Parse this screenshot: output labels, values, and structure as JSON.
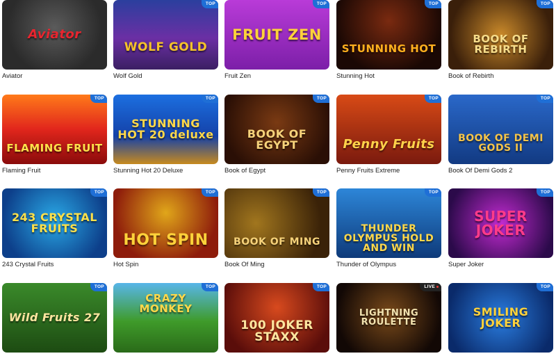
{
  "badges": {
    "top": "TOP",
    "live": "LIVE"
  },
  "games": [
    {
      "title": "Aviator",
      "art": "Aviator",
      "badge": ""
    },
    {
      "title": "Wolf Gold",
      "art": "WOLF GOLD",
      "badge": "TOP"
    },
    {
      "title": "Fruit Zen",
      "art": "FRUIT ZEN",
      "badge": "TOP"
    },
    {
      "title": "Stunning Hot",
      "art": "STUNNING HOT",
      "badge": "TOP"
    },
    {
      "title": "Book of Rebirth",
      "art": "BOOK OF REBIRTH",
      "badge": "TOP"
    },
    {
      "title": "Flaming Fruit",
      "art": "FLAMING FRUIT",
      "badge": "TOP"
    },
    {
      "title": "Stunning Hot 20 Deluxe",
      "art": "STUNNING HOT 20 deluxe",
      "badge": "TOP"
    },
    {
      "title": "Book of Egypt",
      "art": "BOOK OF EGYPT",
      "badge": "TOP"
    },
    {
      "title": "Penny Fruits Extreme",
      "art": "Penny Fruits",
      "badge": "TOP"
    },
    {
      "title": "Book Of Demi Gods 2",
      "art": "BOOK OF DEMI GODS II",
      "badge": "TOP"
    },
    {
      "title": "243 Crystal Fruits",
      "art": "243 CRYSTAL FRUITS",
      "badge": "TOP"
    },
    {
      "title": "Hot Spin",
      "art": "HOT SPIN",
      "badge": "TOP"
    },
    {
      "title": "Book Of Ming",
      "art": "BOOK OF MING",
      "badge": "TOP"
    },
    {
      "title": "Thunder of Olympus",
      "art": "THUNDER OLYMPUS HOLD AND WIN",
      "badge": "TOP"
    },
    {
      "title": "Super Joker",
      "art": "SUPER JOKER",
      "badge": "TOP"
    },
    {
      "title": "",
      "art": "Wild Fruits 27",
      "badge": "TOP"
    },
    {
      "title": "",
      "art": "CRAZY MONKEY",
      "badge": "TOP"
    },
    {
      "title": "",
      "art": "100 JOKER STAXX",
      "badge": "TOP"
    },
    {
      "title": "",
      "art": "LIGHTNING ROULETTE",
      "badge": "LIVE"
    },
    {
      "title": "",
      "art": "SMILING JOKER",
      "badge": "TOP"
    }
  ]
}
